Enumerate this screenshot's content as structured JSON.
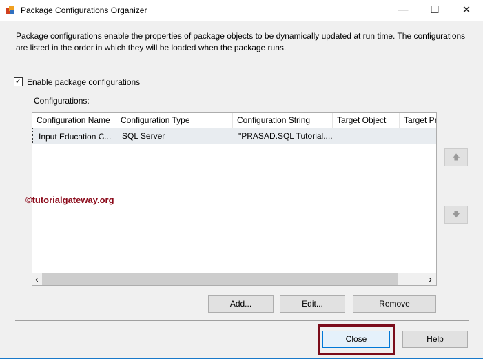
{
  "window": {
    "title": "Package Configurations Organizer",
    "minimize": "—",
    "maximize": "☐",
    "close": "✕"
  },
  "description": "Package configurations enable the properties of package objects to be dynamically updated at run time. The configurations are listed in the order in which they will be loaded when the package runs.",
  "enable_label": "Enable package configurations",
  "enable_checked": true,
  "configs_label": "Configurations:",
  "columns": [
    "Configuration Name",
    "Configuration Type",
    "Configuration String",
    "Target Object",
    "Target Pr"
  ],
  "rows": [
    [
      "Input Education C...",
      "SQL Server",
      "\"PRASAD.SQL Tutorial....",
      "",
      ""
    ]
  ],
  "watermark": "©tutorialgateway.org",
  "buttons": {
    "add": "Add...",
    "edit": "Edit...",
    "remove": "Remove",
    "close": "Close",
    "help": "Help",
    "up": "🡅",
    "down": "🡇"
  },
  "scroll": {
    "left": "‹",
    "right": "›"
  },
  "colors": {
    "highlight": "#7b0c1a"
  }
}
